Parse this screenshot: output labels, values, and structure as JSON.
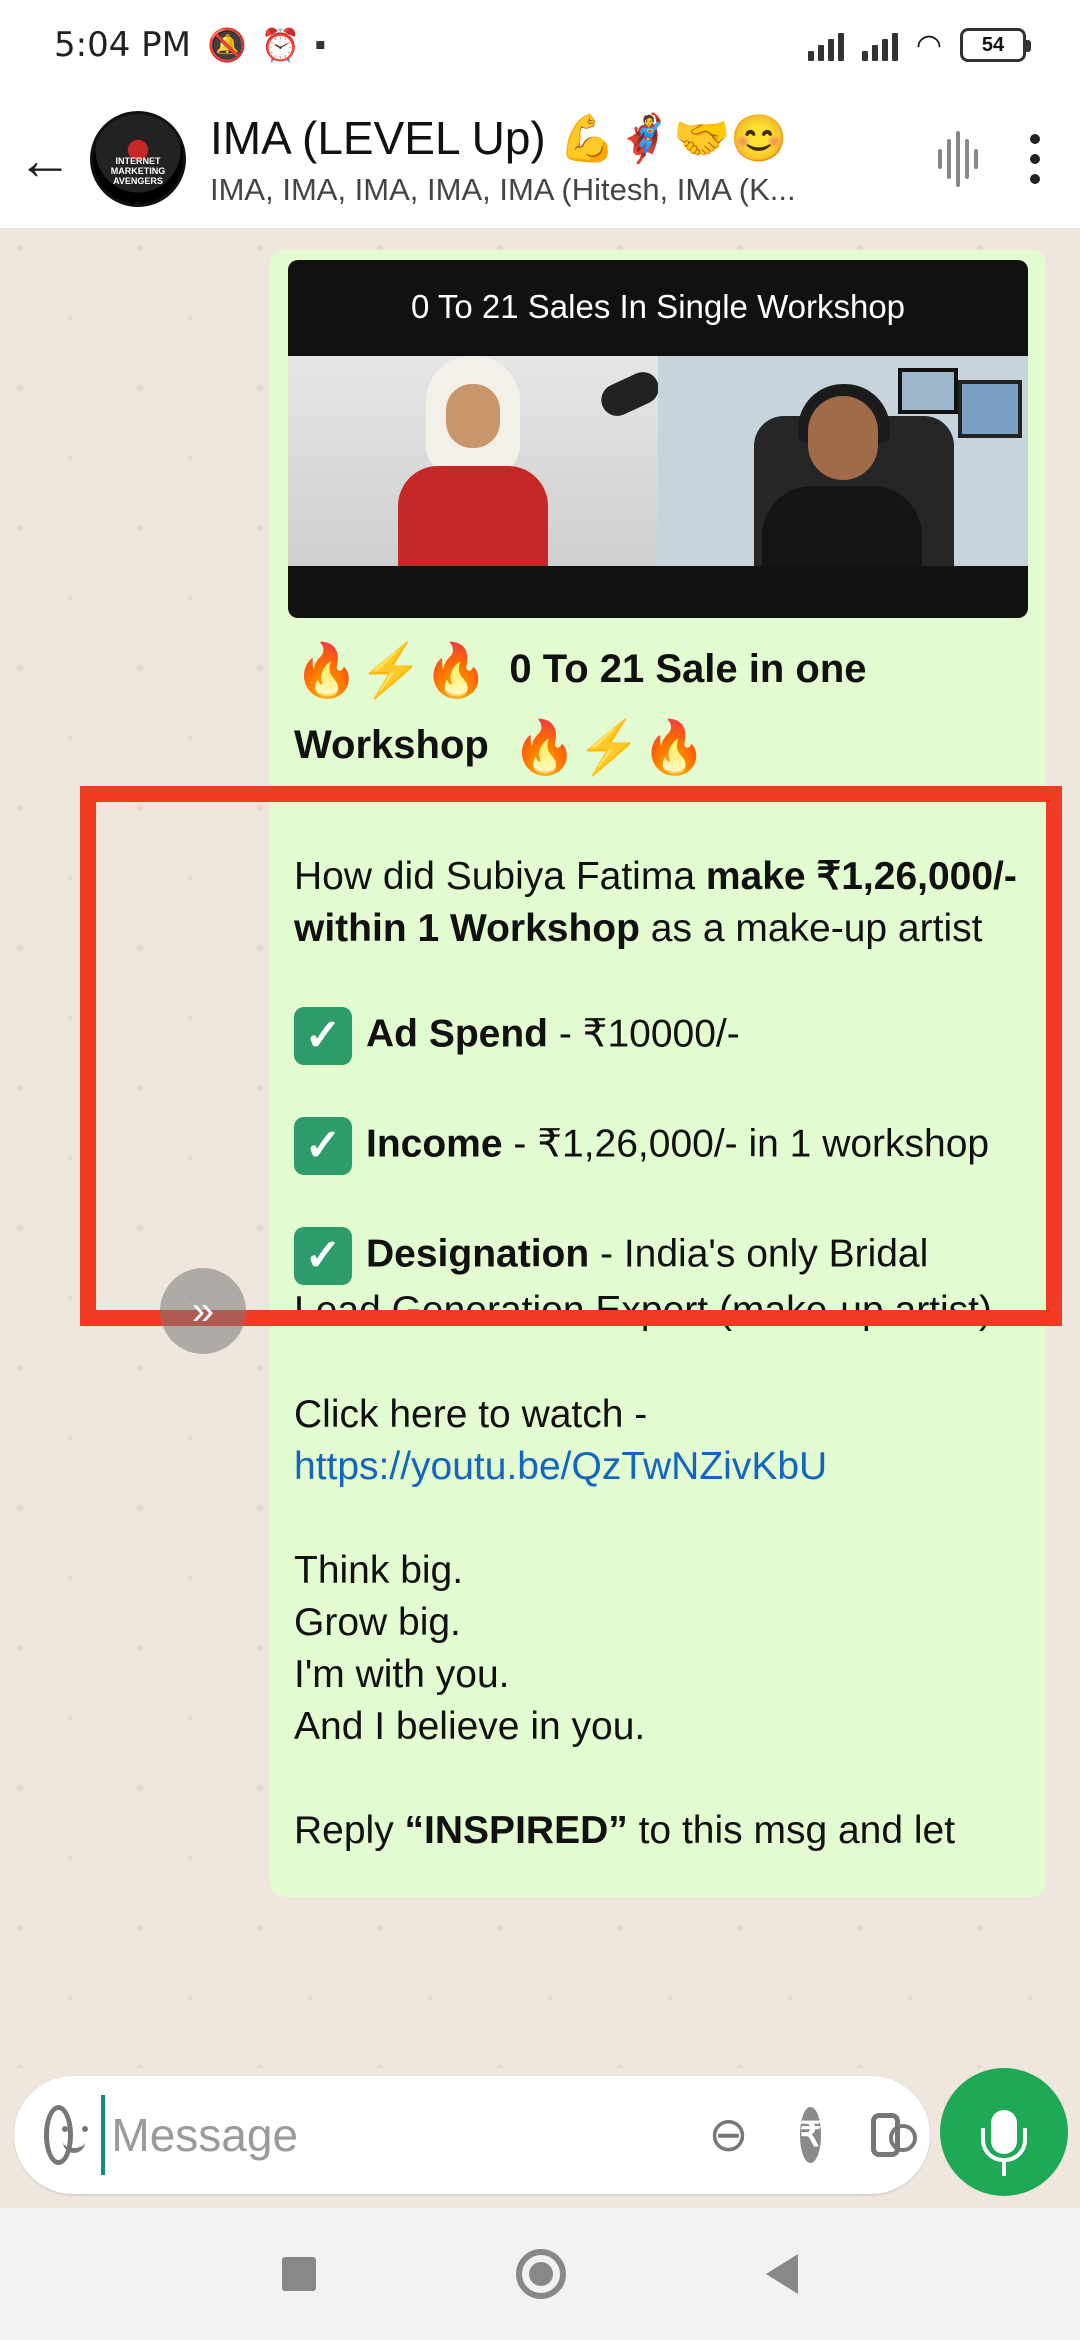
{
  "status_bar": {
    "time": "5:04 PM",
    "battery": "54"
  },
  "header": {
    "title": "IMA (LEVEL Up) 💪🦸🤝😊",
    "subtitle": "IMA, IMA, IMA, IMA, IMA (Hitesh, IMA (K...",
    "avatar_text": "INTERNET MARKETING AVENGERS"
  },
  "message": {
    "video_title": "0 To 21 Sales In Single Workshop",
    "heading_part1": "0 To 21 Sale in one",
    "heading_part2": "Workshop",
    "para1_a": "How did Subiya Fatima ",
    "para1_b": "make ₹1,26,000/- within 1 Workshop",
    "para1_c": " as a make-up artist",
    "ad_label": "Ad Spend",
    "ad_value": " - ₹10000/-",
    "income_label": "Income",
    "income_value": " - ₹1,26,000/- in 1 workshop",
    "designation_label": "Designation",
    "designation_value": " - India's only Bridal Lead Generation Expert (make-up artist)",
    "watch_text": "Click here to watch - ",
    "watch_link": "https://youtu.be/QzTwNZivKbU",
    "line1": "Think big.",
    "line2": "Grow big.",
    "line3": "I'm with you.",
    "line4": "And I believe in you.",
    "reply_a": "Reply ",
    "reply_b": "“INSPIRED”",
    "reply_c": " to this msg and let"
  },
  "composer": {
    "placeholder": "Message",
    "rupee": "₹"
  },
  "colors": {
    "bubble": "#e2fbd0",
    "highlight": "#ef3b22",
    "mic": "#1fa855",
    "link": "#1565c0"
  }
}
